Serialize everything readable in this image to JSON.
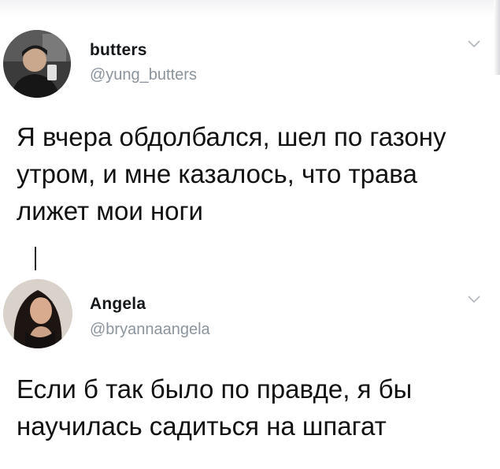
{
  "tweets": [
    {
      "author": {
        "name": "butters",
        "handle": "@yung_butters",
        "avatar_icon": "avatar-photo"
      },
      "text": "Я вчера обдолбался, шел по газону утром, и мне казалось, что трава лижет мои ноги",
      "menu_icon": "chevron-down-icon"
    },
    {
      "author": {
        "name": "Angela",
        "handle": "@bryannaangela",
        "avatar_icon": "avatar-photo"
      },
      "text": "Если б так было по правде, я бы научилась садиться на шпагат",
      "menu_icon": "chevron-down-icon"
    }
  ],
  "colors": {
    "text": "#111111",
    "handle": "#8b949c",
    "chevron": "#b0b6bb",
    "background": "#ffffff"
  }
}
